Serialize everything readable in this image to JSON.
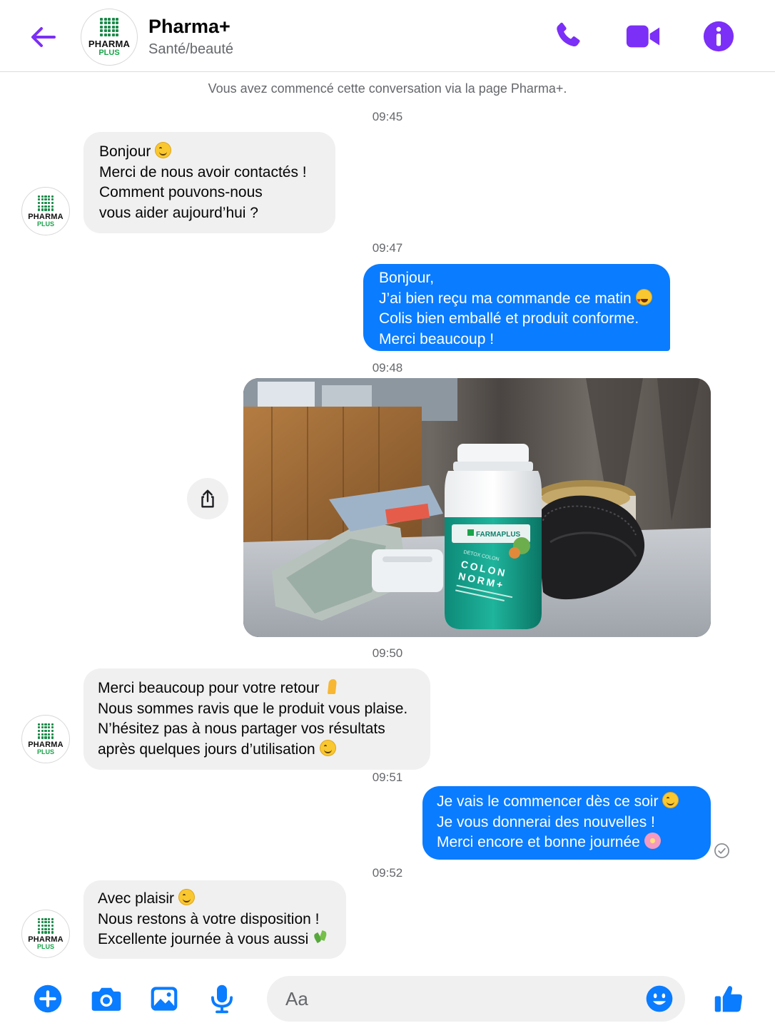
{
  "header": {
    "title": "Pharma+",
    "subtitle": "Santé/beauté",
    "avatar_brand": "PHARMA",
    "avatar_brand_sub": "PLUS"
  },
  "conversation": {
    "notice": "Vous avez commencé cette conversation via la page Pharma+.",
    "times": [
      "09:45",
      "09:47",
      "09:48",
      "09:50",
      "09:51",
      "09:52"
    ],
    "messages": [
      {
        "from": "page",
        "lines": [
          "Bonjour",
          "Merci de nous avoir contactés !",
          "Comment pouvons-nous",
          "vous aider aujourd’hui ?"
        ]
      },
      {
        "from": "me",
        "lines": [
          "Bonjour,",
          "J’ai bien reçu ma commande ce matin",
          "Colis bien emballé et produit conforme.",
          "Merci beaucoup !"
        ]
      },
      {
        "from": "page",
        "lines": [
          "Merci beaucoup pour votre retour",
          "Nous sommes ravis que le produit vous plaise.",
          "N’hésitez pas à nous partager vos résultats",
          "après quelques jours d’utilisation"
        ]
      },
      {
        "from": "me",
        "lines": [
          "Je vais le commencer dès ce soir",
          "Je vous donnerai des nouvelles !",
          "Merci encore et bonne journée"
        ]
      },
      {
        "from": "page",
        "lines": [
          "Avec plaisir",
          "Nous restons à votre disposition !",
          "Excellente journée à vous aussi"
        ]
      }
    ],
    "photo": {
      "product_brand": "FARMAPLUS",
      "product_line": "DETOX COLON",
      "product_name_1": "COLON",
      "product_name_2": "NORM+"
    }
  },
  "composer": {
    "placeholder": "Aa"
  },
  "colors": {
    "accent": "#7b2ff7",
    "outgoing_bubble": "#0a7cff",
    "incoming_bubble": "#f0f0f0",
    "composer_icons": "#0a7cff"
  },
  "icons": {
    "back": "arrow-left-icon",
    "call": "phone-icon",
    "video": "video-camera-icon",
    "info": "info-icon",
    "share": "share-icon",
    "seen": "check-circle-icon",
    "plus": "plus-circle-icon",
    "camera": "camera-icon",
    "gallery": "image-icon",
    "mic": "microphone-icon",
    "emoji": "smiley-icon",
    "like": "thumbs-up-icon"
  }
}
